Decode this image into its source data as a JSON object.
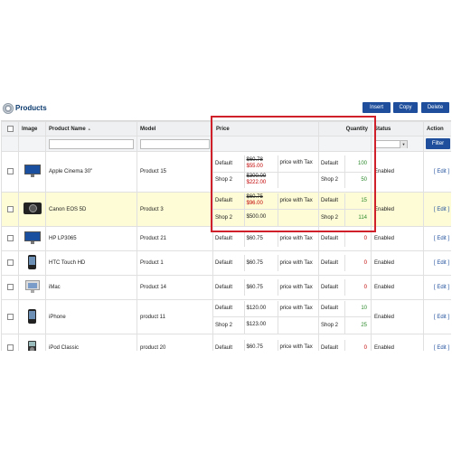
{
  "page": {
    "title": "Products",
    "buttons": {
      "insert": "Insert",
      "copy": "Copy",
      "delete": "Delete",
      "filter": "Filter"
    }
  },
  "columns": {
    "image": "Image",
    "name": "Product Name",
    "model": "Model",
    "price": "Price",
    "quantity": "Quantity",
    "status": "Status",
    "action": "Action"
  },
  "rows": [
    {
      "icon": "monitor-thumbnail-icon",
      "name": "Apple Cinema 30\"",
      "model": "Product 15",
      "prices": [
        {
          "group": "Default",
          "old": "$60.78",
          "new": "$55.00",
          "tax": "price with Tax"
        },
        {
          "group": "Shop 2",
          "old": "$300.00",
          "new": "$222.00",
          "tax": ""
        }
      ],
      "quantities": [
        {
          "group": "Default",
          "value": "100"
        },
        {
          "group": "Shop 2",
          "value": "50"
        }
      ],
      "status": "Enabled",
      "action": "[ Edit ]",
      "highlighted": false
    },
    {
      "icon": "camera-thumbnail-icon",
      "name": "Canon EOS 5D",
      "model": "Product 3",
      "prices": [
        {
          "group": "Default",
          "old": "$60.75",
          "new": "$96.00",
          "tax": "price with Tax"
        },
        {
          "group": "Shop 2",
          "old": "",
          "new": "$500.00",
          "tax": ""
        }
      ],
      "quantities": [
        {
          "group": "Default",
          "value": "15"
        },
        {
          "group": "Shop 2",
          "value": "114"
        }
      ],
      "status": "Enabled",
      "action": "[ Edit ]",
      "highlighted": true
    },
    {
      "icon": "monitor-thumbnail-icon",
      "name": "HP LP3065",
      "model": "Product 21",
      "prices": [
        {
          "group": "Default",
          "old": "",
          "new": "$60.75",
          "tax": "price with Tax"
        }
      ],
      "quantities": [
        {
          "group": "Default",
          "value": "0"
        }
      ],
      "status": "Enabled",
      "action": "[ Edit ]",
      "highlighted": false
    },
    {
      "icon": "phone-thumbnail-icon",
      "name": "HTC Touch HD",
      "model": "Product 1",
      "prices": [
        {
          "group": "Default",
          "old": "",
          "new": "$60.75",
          "tax": "price with Tax"
        }
      ],
      "quantities": [
        {
          "group": "Default",
          "value": "0"
        }
      ],
      "status": "Enabled",
      "action": "[ Edit ]",
      "highlighted": false
    },
    {
      "icon": "imac-thumbnail-icon",
      "name": "iMac",
      "model": "Product 14",
      "prices": [
        {
          "group": "Default",
          "old": "",
          "new": "$60.75",
          "tax": "price with Tax"
        }
      ],
      "quantities": [
        {
          "group": "Default",
          "value": "0"
        }
      ],
      "status": "Enabled",
      "action": "[ Edit ]",
      "highlighted": false
    },
    {
      "icon": "phone-thumbnail-icon",
      "name": "iPhone",
      "model": "product 11",
      "prices": [
        {
          "group": "Default",
          "old": "",
          "new": "$120.00",
          "tax": "price with Tax"
        },
        {
          "group": "Shop 2",
          "old": "",
          "new": "$123.00",
          "tax": ""
        }
      ],
      "quantities": [
        {
          "group": "Default",
          "value": "10"
        },
        {
          "group": "Shop 2",
          "value": "25"
        }
      ],
      "status": "Enabled",
      "action": "[ Edit ]",
      "highlighted": false
    },
    {
      "icon": "ipod-thumbnail-icon",
      "name": "iPod Classic",
      "model": "product 20",
      "prices": [
        {
          "group": "Default",
          "old": "",
          "new": "$60.75",
          "tax": "price with Tax"
        }
      ],
      "quantities": [
        {
          "group": "Default",
          "value": "0"
        }
      ],
      "status": "Enabled",
      "action": "[ Edit ]",
      "highlighted": false
    }
  ],
  "colors": {
    "accent": "#1f4f9c",
    "highlight_row": "#fefcd6",
    "annotation_border": "#d0202a",
    "qty_positive": "#2d8a2d",
    "qty_zero": "#c00000"
  }
}
